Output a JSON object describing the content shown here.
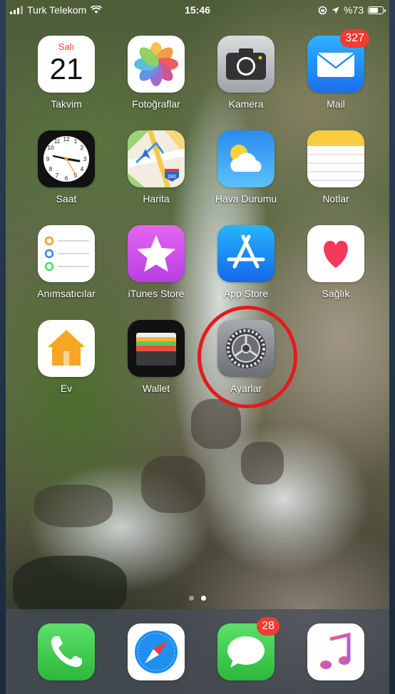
{
  "status_bar": {
    "carrier": "Turk Telekom",
    "time": "15:46",
    "battery_text": "%73",
    "battery_level": 0.73
  },
  "apps": [
    {
      "id": "calendar",
      "label": "Takvim",
      "day_name": "Salı",
      "day_num": "21"
    },
    {
      "id": "photos",
      "label": "Fotoğraflar"
    },
    {
      "id": "camera",
      "label": "Kamera"
    },
    {
      "id": "mail",
      "label": "Mail",
      "badge": "327"
    },
    {
      "id": "clock",
      "label": "Saat"
    },
    {
      "id": "maps",
      "label": "Harita",
      "road_sign": "280"
    },
    {
      "id": "weather",
      "label": "Hava Durumu"
    },
    {
      "id": "notes",
      "label": "Notlar"
    },
    {
      "id": "reminders",
      "label": "Anımsatıcılar"
    },
    {
      "id": "itunes",
      "label": "iTunes Store"
    },
    {
      "id": "appstore",
      "label": "App Store"
    },
    {
      "id": "health",
      "label": "Sağlık"
    },
    {
      "id": "home",
      "label": "Ev"
    },
    {
      "id": "wallet",
      "label": "Wallet"
    },
    {
      "id": "settings",
      "label": "Ayarlar"
    }
  ],
  "page_indicator": {
    "pages": 2,
    "current": 2
  },
  "dock": [
    {
      "id": "phone",
      "icon": "phone-icon"
    },
    {
      "id": "safari",
      "icon": "safari-icon"
    },
    {
      "id": "messages",
      "icon": "messages-icon",
      "badge": "28"
    },
    {
      "id": "music",
      "icon": "music-icon"
    }
  ],
  "colors": {
    "badge": "#f03c31",
    "highlight_ring": "#e41a1c"
  }
}
